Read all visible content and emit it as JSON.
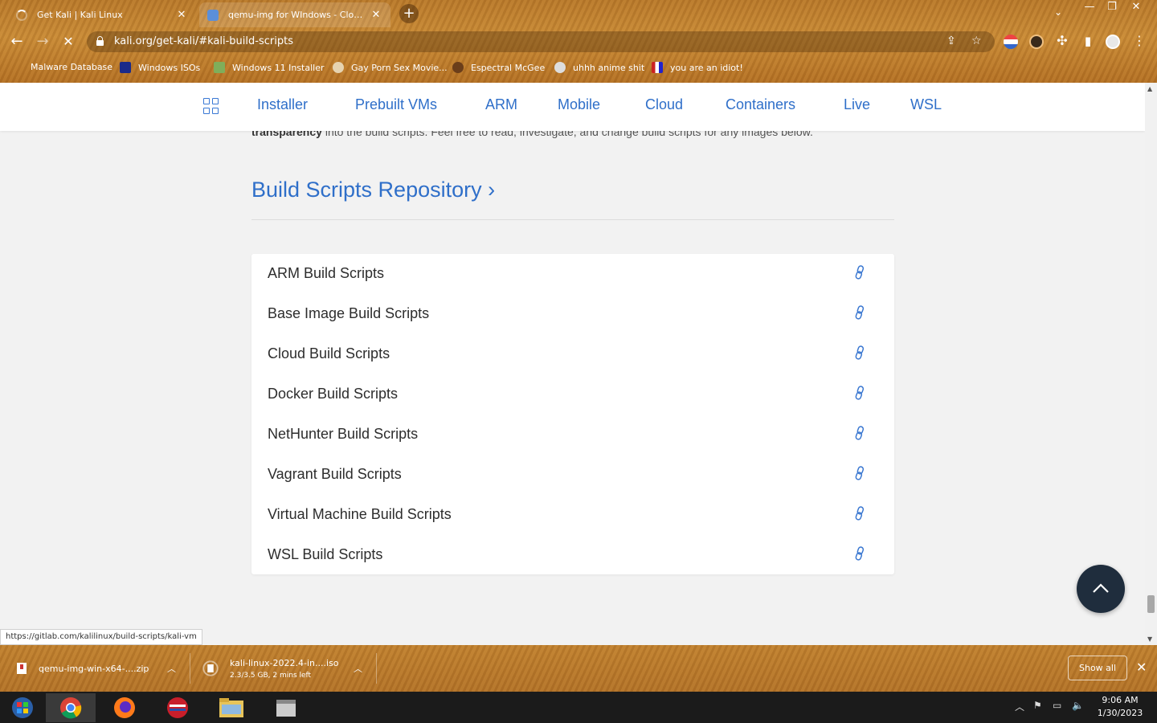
{
  "browser": {
    "tabs": [
      {
        "title": "Get Kali | Kali Linux",
        "close": "✕"
      },
      {
        "title": "qemu-img for WIndows - Cloudbase Solutions",
        "close": "✕"
      }
    ],
    "new_tab": "+",
    "tab_search": "⌄",
    "window_controls": [
      "—",
      "❐",
      "✕"
    ],
    "url": "kali.org/get-kali/#kali-build-scripts",
    "bookmarks": [
      {
        "label": "Malware Database"
      },
      {
        "label": "Windows ISOs"
      },
      {
        "label": "Windows 11 Installer"
      },
      {
        "label": "Gay Porn Sex Movie..."
      },
      {
        "label": "Espectral McGee"
      },
      {
        "label": "uhhh anime shit"
      },
      {
        "label": "you are an idiot!"
      }
    ],
    "status_url": "https://gitlab.com/kalilinux/build-scripts/kali-vm"
  },
  "site_nav": {
    "items": [
      "Installer",
      "Prebuilt VMs",
      "ARM",
      "Mobile",
      "Cloud",
      "Containers",
      "Live",
      "WSL"
    ]
  },
  "page": {
    "intro_bold": "transparency",
    "intro_rest": " into the build scripts. Feel free to read, investigate, and change build scripts for any images below.",
    "repo_title": "Build Scripts Repository ›",
    "scripts": [
      "ARM Build Scripts",
      "Base Image Build Scripts",
      "Cloud Build Scripts",
      "Docker Build Scripts",
      "NetHunter Build Scripts",
      "Vagrant Build Scripts",
      "Virtual Machine Build Scripts",
      "WSL Build Scripts"
    ]
  },
  "downloads": {
    "items": [
      {
        "name": "qemu-img-win-x64-....zip",
        "sub": ""
      },
      {
        "name": "kali-linux-2022.4-in....iso",
        "sub": "2.3/3.5 GB, 2 mins left"
      }
    ],
    "show_all": "Show all",
    "close": "✕"
  },
  "taskbar": {
    "time": "9:06 AM",
    "date": "1/30/2023"
  },
  "colors": {
    "accent": "#2f6fc9",
    "chrome": "#c08030",
    "to_top_button": "#1f2d3d"
  }
}
